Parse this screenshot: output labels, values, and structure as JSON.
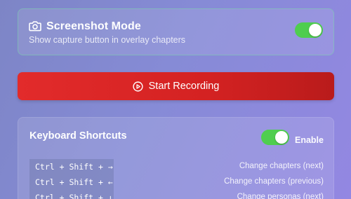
{
  "screenshot_mode": {
    "icon": "camera-icon",
    "title": "Screenshot Mode",
    "subtitle": "Show capture button in overlay chapters",
    "toggle_on": true
  },
  "record_button": {
    "icon": "play-circle-icon",
    "label": "Start Recording"
  },
  "shortcuts": {
    "title": "Keyboard Shortcuts",
    "enabled": true,
    "enable_label": "Enable",
    "rows": [
      {
        "keys": "Ctrl + Shift + →",
        "description": "Change chapters (next)"
      },
      {
        "keys": "Ctrl + Shift + ←",
        "description": "Change chapters (previous)"
      },
      {
        "keys": "Ctrl + Shift + ↓",
        "description": "Change personas (next)"
      }
    ]
  },
  "colors": {
    "toggle_on": "#4fce4f",
    "record_button": "#d42222",
    "card_border_accent": "#78d2aa"
  }
}
